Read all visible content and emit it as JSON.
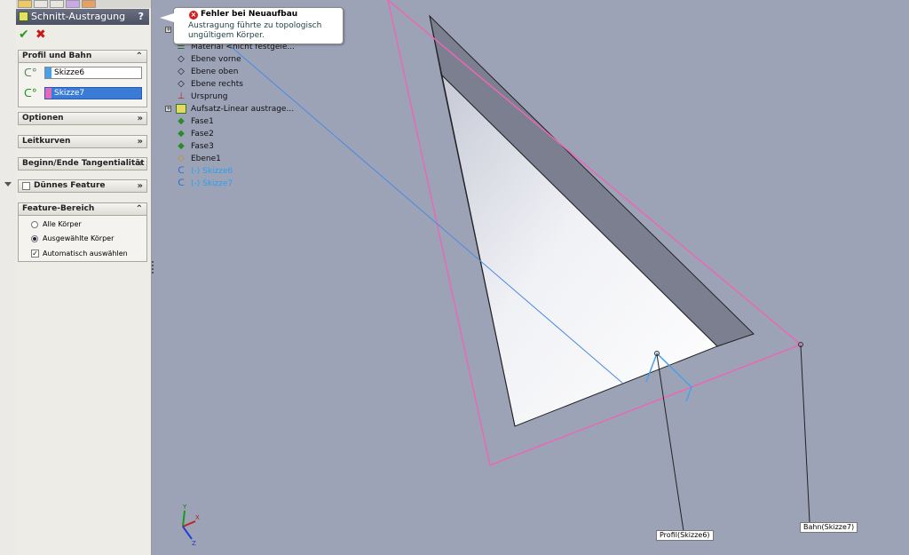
{
  "property_manager": {
    "title": "Schnitt-Austragung",
    "help": "?",
    "ok_icon": "✔",
    "cancel_icon": "✖",
    "groups": {
      "profil": {
        "label": "Profil und Bahn",
        "profile_value": "Skizze6",
        "path_value": "Skizze7",
        "profile_color": "#4aa0e8",
        "path_color": "#e868b8"
      },
      "optionen": {
        "label": "Optionen"
      },
      "leitkurven": {
        "label": "Leitkurven"
      },
      "tangent": {
        "label": "Beginn/Ende Tangentialität"
      },
      "duenn": {
        "label": "Dünnes Feature"
      },
      "bereich": {
        "label": "Feature-Bereich",
        "opt_all": "Alle Körper",
        "opt_selected": "Ausgewählte Körper",
        "opt_auto": "Automatisch auswählen"
      }
    }
  },
  "tooltip": {
    "title": "Fehler bei Neuaufbau",
    "message": "Austragung führte zu topologisch ungültigem Körper."
  },
  "tree": [
    {
      "label": "Material <nicht festgele...",
      "icon": "material-icon"
    },
    {
      "label": "Ebene vorne",
      "icon": "plane-icon"
    },
    {
      "label": "Ebene oben",
      "icon": "plane-icon"
    },
    {
      "label": "Ebene rechts",
      "icon": "plane-icon"
    },
    {
      "label": "Ursprung",
      "icon": "origin-icon"
    },
    {
      "label": "Aufsatz-Linear austrage...",
      "icon": "extrude-icon"
    },
    {
      "label": "Fase1",
      "icon": "chamfer-icon"
    },
    {
      "label": "Fase2",
      "icon": "chamfer-icon"
    },
    {
      "label": "Fase3",
      "icon": "chamfer-icon"
    },
    {
      "label": "Ebene1",
      "icon": "plane-icon"
    },
    {
      "label": "(-) Skizze6",
      "icon": "sketch-icon"
    },
    {
      "label": "(-) Skizze7",
      "icon": "sketch-icon"
    }
  ],
  "callouts": {
    "profile": "Profil(Skizze6)",
    "path": "Bahn(Skizze7)"
  },
  "triad": {
    "x": "X",
    "y": "Y",
    "z": "Z"
  },
  "colors": {
    "background": "#9da3b7",
    "path_sketch": "#e868b8",
    "profile_sketch": "#4aa0e8",
    "accent_title": "#4b5063"
  }
}
